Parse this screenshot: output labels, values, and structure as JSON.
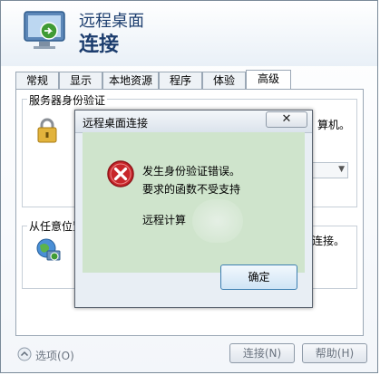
{
  "app": {
    "subtitle": "远程桌面",
    "title": "连接"
  },
  "tabs": [
    {
      "label": "常规"
    },
    {
      "label": "显示"
    },
    {
      "label": "本地资源"
    },
    {
      "label": "程序"
    },
    {
      "label": "体验"
    },
    {
      "label": "高级"
    }
  ],
  "panel": {
    "server_auth_label": "服务器身份验证",
    "server_auth_text_tail": "算机。",
    "connect_anywhere_label": "从任意位置",
    "connect_anywhere_text_tail": "连接。"
  },
  "footer": {
    "options_label": "选项(O)",
    "connect_label": "连接(N)",
    "help_label": "帮助(H)"
  },
  "dialog": {
    "title": "远程桌面连接",
    "close_label": "✕",
    "line1": "发生身份验证错误。",
    "line2": "要求的函数不受支持",
    "line3": "远程计算",
    "ok_label": "确定"
  },
  "colors": {
    "header_text": "#1c3d6e",
    "dialog_body_bg": "#cfe4cc",
    "error_red": "#c8262a"
  }
}
